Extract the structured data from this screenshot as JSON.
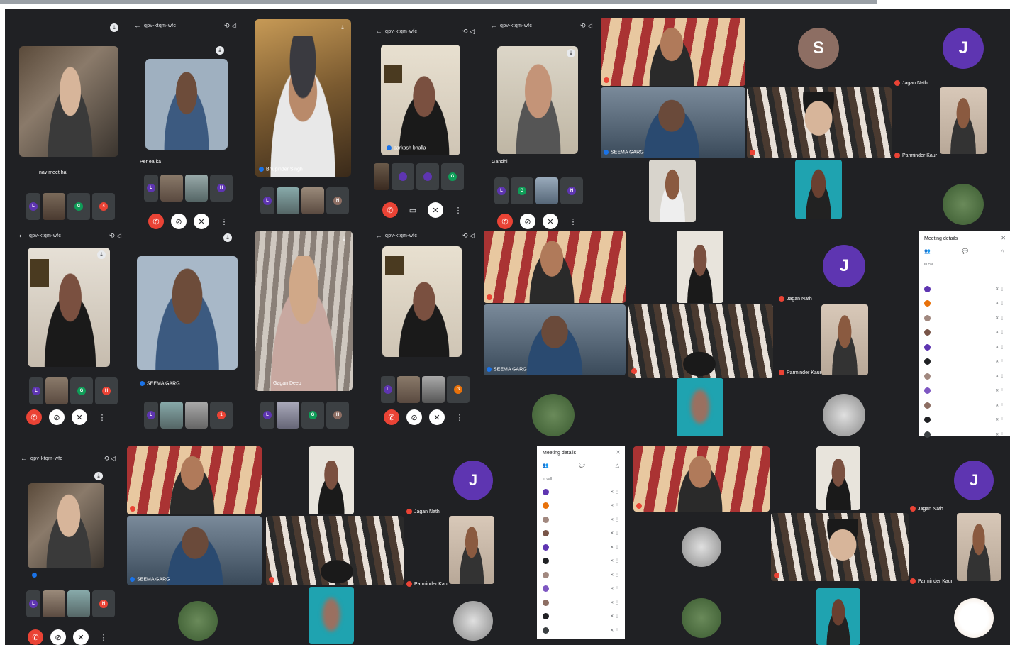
{
  "colors": {
    "background": "#202124",
    "accent_purple": "#5e35b1",
    "end_call_red": "#ea4335",
    "avatar_brown": "#8d6e63",
    "meet_blue": "#1a73e8"
  },
  "avatars": {
    "s": "S",
    "j": "J"
  },
  "phone1": {
    "name": "nav meet hal"
  },
  "phone2": {
    "status": "",
    "code": "qpv-ktqm-wfc",
    "name": "Per ea ka"
  },
  "phone3": {
    "name": "Bhupinder Singh"
  },
  "phone4": {
    "code": "qpv-ktqm-wfc",
    "name": "parkash bhalla"
  },
  "phone5": {
    "code": "qpv-ktqm-wfc",
    "name": "Gandhi"
  },
  "phone6": {
    "code": "qpv-ktqm-wfc",
    "name": ""
  },
  "phone7": {
    "name": "SEEMA GARG"
  },
  "phone8": {
    "name": "Gagan Deep"
  },
  "phone9": {
    "code": "qpv-ktqm-wfc",
    "name": ""
  },
  "phone10": {
    "code": "qpv-ktqm-wfc",
    "name": ""
  },
  "grid_labels": {
    "jagan_nath": "Jagan Nath",
    "seema_garg": "SEEMA GARG",
    "parminder_kaur": "Parminder Kaur"
  },
  "meeting_details": {
    "title": "Meeting details",
    "section": "In call",
    "people": [
      {
        "name": "",
        "color": "#5e35b1"
      },
      {
        "name": "",
        "color": "#e8710a"
      },
      {
        "name": "",
        "color": "#a1887f"
      },
      {
        "name": "",
        "color": "#795548"
      },
      {
        "name": "",
        "color": "#5e35b1"
      },
      {
        "name": "",
        "color": "#202124"
      },
      {
        "name": "",
        "color": "#a1887f"
      },
      {
        "name": "",
        "color": "#7e57c2"
      },
      {
        "name": "",
        "color": "#8d6e63"
      },
      {
        "name": "",
        "color": "#202124"
      },
      {
        "name": "",
        "color": "#3c4043"
      }
    ]
  },
  "icons": {
    "end_call": "✆",
    "mic_off": "🎙",
    "video_off": "⊘",
    "more": "⋮",
    "back": "←",
    "close": "✕",
    "people": "👥",
    "chat": "💬",
    "activities": "△"
  }
}
